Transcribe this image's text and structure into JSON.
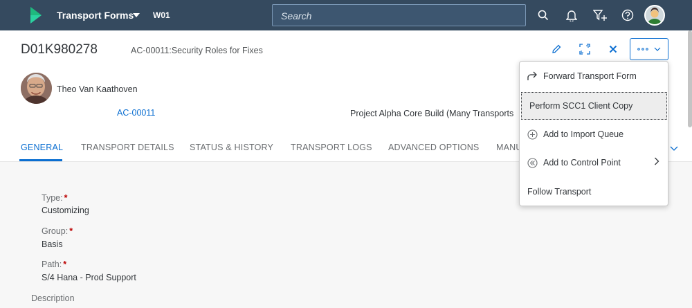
{
  "shell": {
    "app_title": "Transport Forms",
    "system": "W01",
    "search_placeholder": "Search",
    "icons": [
      "search-icon",
      "bell-icon",
      "filter-add-icon",
      "help-icon"
    ],
    "bg_color": "#354a5f"
  },
  "header": {
    "object_id": "D01K980278",
    "object_subtitle": "AC-00011:Security Roles for Fixes",
    "person_name": "Theo Van Kaathoven",
    "link_id": "AC-00011",
    "project": "Project Alpha Core Build (Many Transports"
  },
  "tabs": [
    {
      "label": "GENERAL",
      "active": true
    },
    {
      "label": "TRANSPORT DETAILS"
    },
    {
      "label": "STATUS & HISTORY"
    },
    {
      "label": "TRANSPORT LOGS"
    },
    {
      "label": "ADVANCED OPTIONS"
    },
    {
      "label": "MANU"
    }
  ],
  "fields": [
    {
      "label": "Type:",
      "value": "Customizing",
      "required": "*"
    },
    {
      "label": "Group:",
      "value": "Basis",
      "required": "*"
    },
    {
      "label": "Path:",
      "value": "S/4 Hana - Prod Support",
      "required": "*"
    }
  ],
  "description_label": "Description",
  "menu": {
    "items": [
      {
        "label": "Forward Transport Form",
        "icon": "forward-icon"
      },
      {
        "label": "Perform SCC1 Client Copy",
        "focused": true
      },
      {
        "label": "Add to Import Queue",
        "icon": "add-circle-icon"
      },
      {
        "label": "Add to Control Point",
        "icon": "double-back-icon",
        "has_submenu": true
      },
      {
        "label": "Follow Transport"
      }
    ]
  },
  "colors": {
    "accent": "#0a6ed1",
    "required": "#bb0000"
  }
}
